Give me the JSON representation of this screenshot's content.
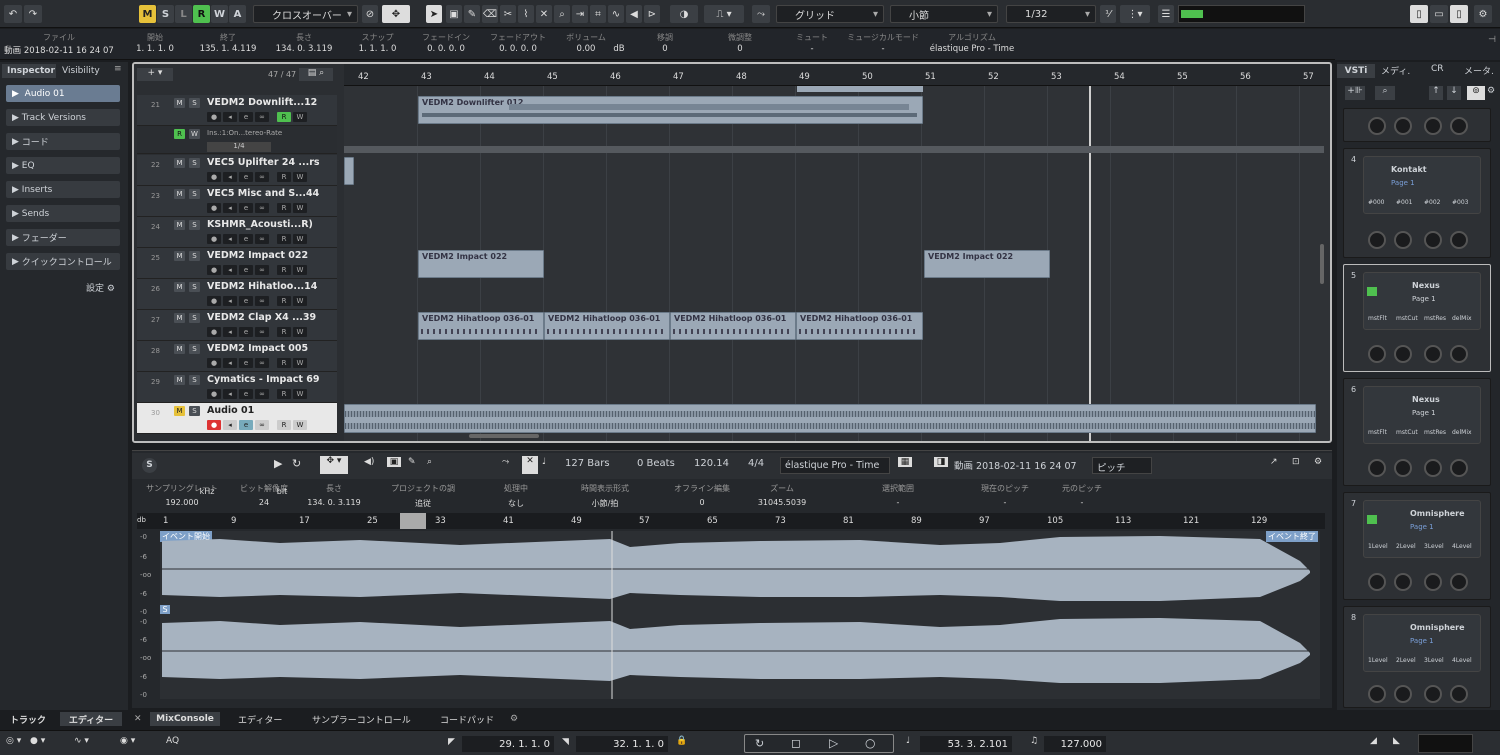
{
  "toolbar": {
    "msl": [
      "M",
      "S",
      "L",
      "R",
      "W",
      "A"
    ],
    "crossover": "クロスオーバー",
    "grid": "グリッド",
    "bar": "小節",
    "quant": "1/32"
  },
  "info": {
    "cols": [
      {
        "h": "ファイル",
        "v": "動画 2018-02-11 16 24 07"
      },
      {
        "h": "開始",
        "v": "1. 1. 1.   0"
      },
      {
        "h": "終了",
        "v": "135. 1. 4.119"
      },
      {
        "h": "長さ",
        "v": "134. 0. 3.119"
      },
      {
        "h": "スナップ",
        "v": "1. 1. 1.   0"
      },
      {
        "h": "フェードイン",
        "v": "0. 0. 0.   0"
      },
      {
        "h": "フェードアウト",
        "v": "0. 0. 0.   0"
      },
      {
        "h": "ボリューム",
        "v": "0.00"
      },
      {
        "h": "",
        "v": "dB"
      },
      {
        "h": "移調",
        "v": "0"
      },
      {
        "h": "微調整",
        "v": "0"
      },
      {
        "h": "ミュート",
        "v": "-"
      },
      {
        "h": "ミュージカルモード",
        "v": "-"
      },
      {
        "h": "アルゴリズム",
        "v": "élastique Pro - Time"
      }
    ]
  },
  "inspector": {
    "tabs": [
      "Inspector",
      "Visibility"
    ],
    "track": "Audio 01",
    "sections": [
      "Track Versions",
      "コード",
      "EQ",
      "Inserts",
      "Sends",
      "フェーダー",
      "クイックコントロール"
    ],
    "settings": "設定"
  },
  "project": {
    "count": "47 / 47",
    "ruler": [
      "42",
      "43",
      "44",
      "45",
      "46",
      "47",
      "48",
      "49",
      "50",
      "51",
      "52",
      "53",
      "54",
      "55",
      "56",
      "57"
    ],
    "tracks": [
      {
        "n": "21",
        "name": "VEDM2 Downlift...12"
      },
      {
        "n": "",
        "name": "Ins.:1:On...tereo-Rate"
      },
      {
        "n": "22",
        "name": "VEC5 Uplifter 24 ...rs"
      },
      {
        "n": "23",
        "name": "VEC5 Misc and S...44"
      },
      {
        "n": "24",
        "name": "KSHMR_Acousti...R)"
      },
      {
        "n": "25",
        "name": "VEDM2 Impact 022"
      },
      {
        "n": "26",
        "name": "VEDM2 Hihatloo...14"
      },
      {
        "n": "27",
        "name": "VEDM2 Clap X4 ...39"
      },
      {
        "n": "28",
        "name": "VEDM2 Impact 005"
      },
      {
        "n": "29",
        "name": "Cymatics - Impact 69"
      },
      {
        "n": "30",
        "name": "Audio 01"
      }
    ],
    "automation_value": "1/4",
    "clips": [
      {
        "name": "VEDM2 Downlifter 012"
      },
      {
        "name": "VEDM2 Impact 022"
      },
      {
        "name": "VEDM2 Impact 022"
      },
      {
        "name": "VEDM2 Hihatloop 036-01"
      },
      {
        "name": "VEDM2 Hihatloop 036-01"
      },
      {
        "name": "VEDM2 Hihatloop 036-01"
      },
      {
        "name": "VEDM2 Hihatloop 036-01"
      }
    ]
  },
  "editor": {
    "bars": "127 Bars",
    "beats": "0 Beats",
    "tempo": "120.14",
    "sig": "4/4",
    "algo": "élastique Pro - Time",
    "file": "動画 2018-02-11 16 24 07",
    "pitch": "ピッチ",
    "cols": [
      {
        "h": "サンプリングレート",
        "v": "192.000"
      },
      {
        "h": "",
        "v": "kHz"
      },
      {
        "h": "ビット解像度",
        "v": "24"
      },
      {
        "h": "",
        "v": "bit"
      },
      {
        "h": "長さ",
        "v": "134. 0. 3.119"
      },
      {
        "h": "プロジェクトの調",
        "v": "追従"
      },
      {
        "h": "処理中",
        "v": "なし"
      },
      {
        "h": "時間表示形式",
        "v": "小節/拍"
      },
      {
        "h": "オフライン編集",
        "v": "0"
      },
      {
        "h": "ズーム",
        "v": "31045.5039"
      },
      {
        "h": "選択範囲",
        "v": "-"
      },
      {
        "h": "現在のピッチ",
        "v": "-"
      },
      {
        "h": "元のピッチ",
        "v": "-"
      }
    ],
    "db": "db",
    "ruler": [
      "1",
      "9",
      "17",
      "25",
      "33",
      "41",
      "49",
      "57",
      "65",
      "73",
      "81",
      "89",
      "97",
      "105",
      "113",
      "121",
      "129"
    ],
    "event_start": "イベント開始",
    "event_end": "イベント終了",
    "db_labels": [
      "-0",
      "-6",
      "-oo",
      "-6",
      "-0"
    ]
  },
  "vsti": {
    "tabs": [
      "VSTi",
      "メディ.",
      "CR",
      "メータ."
    ],
    "slots": [
      {
        "n": "4",
        "name": "Kontakt",
        "page": "Page 1",
        "params": [
          "#000",
          "#001",
          "#002",
          "#003"
        ]
      },
      {
        "n": "5",
        "name": "Nexus",
        "page": "Page 1",
        "params": [
          "mstFlt",
          "mstCut",
          "mstRes",
          "delMix"
        ]
      },
      {
        "n": "6",
        "name": "Nexus",
        "page": "Page 1",
        "params": [
          "mstFlt",
          "mstCut",
          "mstRes",
          "delMix"
        ]
      },
      {
        "n": "7",
        "name": "Omnisphere",
        "page": "Page 1",
        "params": [
          "1Level",
          "2Level",
          "3Level",
          "4Level"
        ]
      },
      {
        "n": "8",
        "name": "Omnisphere",
        "page": "Page 1",
        "params": [
          "1Level",
          "2Level",
          "3Level",
          "4Level"
        ]
      }
    ]
  },
  "bottom_tabs": {
    "left": [
      "トラック",
      "エディター"
    ],
    "center": [
      "MixConsole",
      "エディター",
      "サンプラーコントロール",
      "コードパッド"
    ]
  },
  "transport": {
    "left_loc": "29. 1. 1.   0",
    "right_loc": "32. 1. 1.   0",
    "position": "53. 3. 2.101",
    "tempo": "127.000"
  },
  "colors": {
    "accent_yellow": "#e6c13a",
    "accent_green": "#4fc04f",
    "clip": "#9ba8b6"
  }
}
